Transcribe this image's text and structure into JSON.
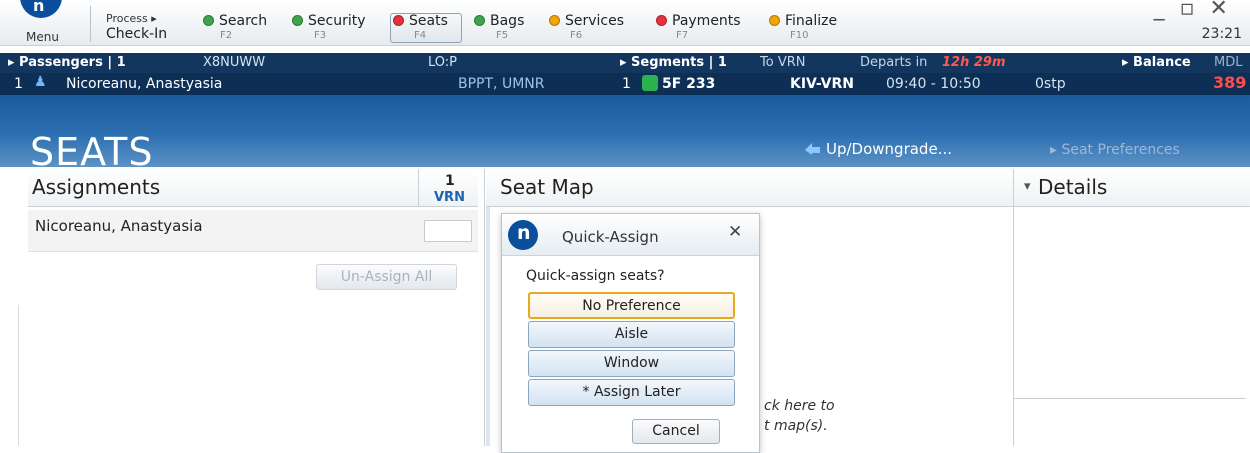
{
  "topbar": {
    "menu_label": "Menu",
    "process_label": "Process ▸",
    "checkin_label": "Check-In",
    "steps": [
      {
        "label": "Search",
        "key": "F2",
        "color": "#3fa34d"
      },
      {
        "label": "Security",
        "key": "F3",
        "color": "#3fa34d"
      },
      {
        "label": "Seats",
        "key": "F4",
        "color": "#e2323a"
      },
      {
        "label": "Bags",
        "key": "F5",
        "color": "#3fa34d"
      },
      {
        "label": "Services",
        "key": "F6",
        "color": "#f0a500"
      },
      {
        "label": "Payments",
        "key": "F7",
        "color": "#e2323a"
      },
      {
        "label": "Finalize",
        "key": "F10",
        "color": "#f0a500"
      }
    ],
    "clock": "23:21",
    "window_controls": "_ ▫ ✕"
  },
  "passengers_bar": {
    "title": "▸ Passengers | 1",
    "pnr": "X8NUWW",
    "lo": "LO:P",
    "segments": "▸ Segments | 1",
    "to": "To VRN",
    "departs_label": "Departs in",
    "departs_time": "12h 29m",
    "balance_label": "▸ Balance",
    "currency": "MDL"
  },
  "passenger_row": {
    "index": "1",
    "name": "Nicoreanu, Anastyasia",
    "codes": "BPPT, UMNR",
    "seg_index": "1",
    "flight": "5F 233",
    "route": "KIV-VRN",
    "times": "09:40 - 10:50",
    "stops": "0stp",
    "balance": "389"
  },
  "banner": {
    "title": "SEATS",
    "upgrade": "Up/Downgrade...",
    "seat_prefs": "▸ Seat Preferences"
  },
  "assignments": {
    "title": "Assignments",
    "count": "1",
    "dest": "VRN",
    "passenger": "Nicoreanu, Anastyasia",
    "unassign_all": "Un-Assign All"
  },
  "seatmap": {
    "title": "Seat Map",
    "hint_line1": "ck here to",
    "hint_line2": "t map(s)."
  },
  "details": {
    "title": "Details",
    "collapse_glyph": "▾"
  },
  "dialog": {
    "logo_letter": "n",
    "title": "Quick-Assign",
    "close": "✕",
    "question": "Quick-assign seats?",
    "options": [
      "No Preference",
      "Aisle",
      "Window",
      "* Assign Later"
    ],
    "cancel": "Cancel"
  },
  "colors": {
    "accent_blue": "#0b4f9c",
    "alert_red": "#e2323a",
    "departs_red": "#ff5a4a"
  }
}
